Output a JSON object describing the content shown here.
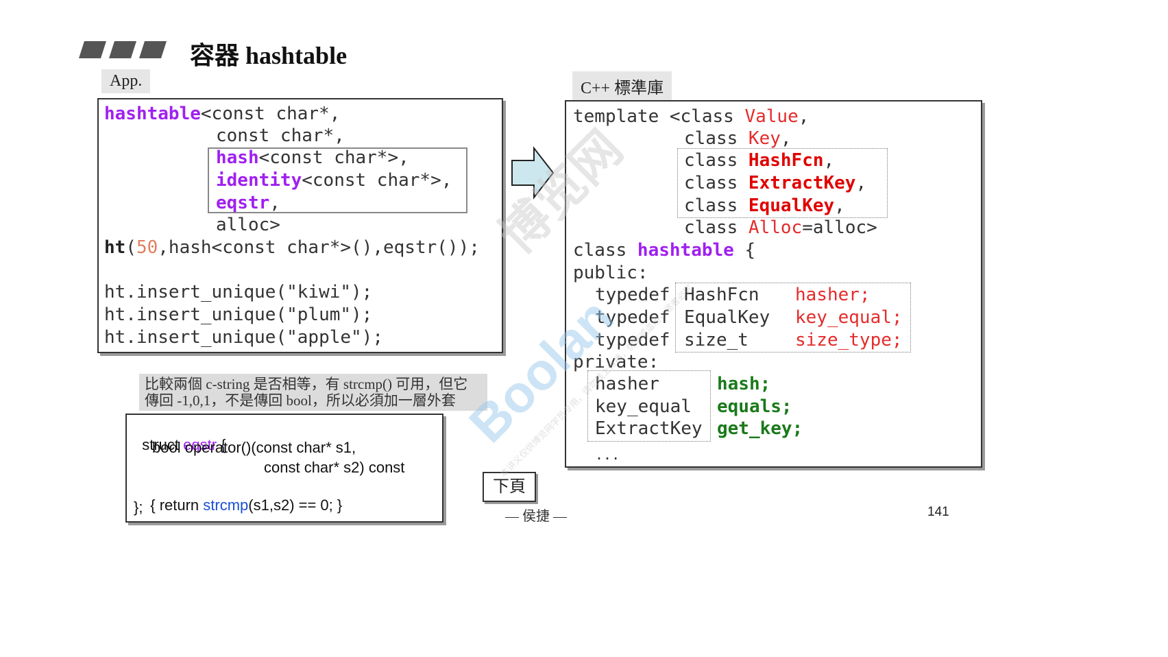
{
  "title": "容器 hashtable",
  "app_label": "App.",
  "lib_label": "C++ 標準庫",
  "app_code": {
    "l1_kw": "hashtable",
    "l1_rest": "<const char*,",
    "l2": "const char*,",
    "l3_kw": "hash",
    "l3_rest": "<const char*>,",
    "l4_kw": "identity",
    "l4_rest": "<const char*>,",
    "l5_kw": "eqstr",
    "l5_rest": ",",
    "l6": "alloc>",
    "l7_kw": "ht",
    "l7_a": "(",
    "l7_num": "50",
    "l7_rest": ",hash<const char*>(),eqstr());",
    "l8": "ht.insert_unique(\"kiwi\");",
    "l9": "ht.insert_unique(\"plum\");",
    "l10": "ht.insert_unique(\"apple\");"
  },
  "note": {
    "line1": "比較兩個 c-string 是否相等，有 strcmp() 可用，但它",
    "line2": "傳回 -1,0,1，不是傳回 bool，所以必須加一層外套"
  },
  "eqstr_code": {
    "l1_a": "struct ",
    "l1_kw": "eqstr",
    "l1_b": " {",
    "l2": "bool operator()(const char* s1,",
    "l3": "const char* s2) const",
    "l4_a": "{ return ",
    "l4_kw": "strcmp",
    "l4_b": "(s1,s2) == 0; }",
    "l5": "};"
  },
  "lib_code": {
    "t1_a": "template <class ",
    "t1_kw": "Value",
    "t1_b": ",",
    "t2_a": "class ",
    "t2_kw": "Key",
    "t2_b": ",",
    "t3_a": "class ",
    "t3_kw": "HashFcn",
    "t3_b": ",",
    "t4_a": "class ",
    "t4_kw": "ExtractKey",
    "t4_b": ",",
    "t5_a": "class ",
    "t5_kw": "EqualKey",
    "t5_b": ",",
    "t6_a": "class ",
    "t6_kw": "Alloc",
    "t6_b": "=alloc>",
    "c1_a": "class ",
    "c1_kw": "hashtable",
    "c1_b": " {",
    "public": "public:",
    "td1_a": "typedef",
    "td1_b": "HashFcn",
    "td1_c": "hasher;",
    "td2_a": "typedef",
    "td2_b": "EqualKey",
    "td2_c": "key_equal;",
    "td3_a": "typedef",
    "td3_b": "size_t",
    "td3_c": "size_type;",
    "private": "private:",
    "m1_a": "hasher",
    "m1_b": "hash;",
    "m2_a": "key_equal",
    "m2_b": "equals;",
    "m3_a": "ExtractKey",
    "m3_b": "get_key;",
    "ellipsis": "..."
  },
  "next_button": "下頁",
  "author": "— 侯捷 —",
  "page_number": "141",
  "watermark": {
    "logo": "Boolan",
    "cn": "博览网",
    "notice": "本讲义仅供博览网学员专用，请勿线上传播，伪造或滥用，违者必究"
  }
}
